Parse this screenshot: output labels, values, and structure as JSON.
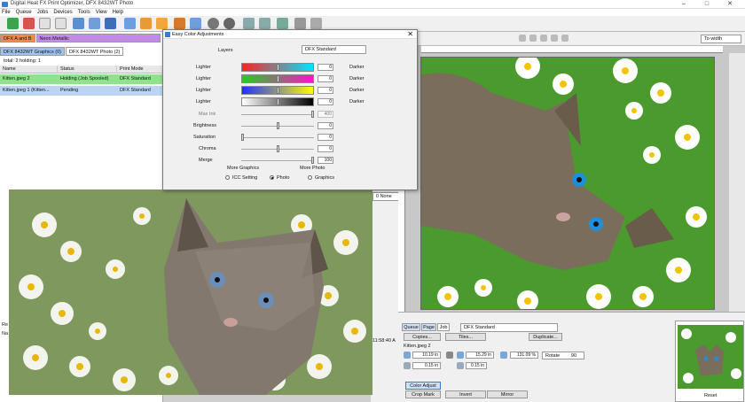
{
  "window": {
    "title": "Digital Heat FX Print Optimizer, DFX 8432WT Photo"
  },
  "menu": [
    "File",
    "Queue",
    "Jobs",
    "Devices",
    "Tools",
    "View",
    "Help"
  ],
  "left_panel": {
    "printer_tabs": [
      "DFX A and B",
      "Neon Metallic"
    ],
    "queue_tabs": [
      "DFX 8432WT Graphics (0)",
      "DFX 8432WT Photo (2)"
    ],
    "summary": "total: 2  holding: 1",
    "columns": [
      "Name",
      "Status",
      "Print Mode"
    ],
    "rows": [
      {
        "name": "Kitten.jpeg 2",
        "status": "Holding (Job Spooled)",
        "mode": "DFX Standard"
      },
      {
        "name": "Kitten.jpeg 1 (Kitten...",
        "status": "Pending",
        "mode": "DFX Standard"
      }
    ],
    "lower_items": [
      "Re",
      "Na"
    ]
  },
  "dialog": {
    "title": "Easy Color Adjustments",
    "layers_label": "Layers",
    "layers_value": "DFX Standard",
    "channels": [
      {
        "left": "Lighter",
        "right": "Darker",
        "value": "0",
        "pos": 0.5,
        "from": "#ff2020",
        "to": "#00e5ff"
      },
      {
        "left": "Lighter",
        "right": "Darker",
        "value": "0",
        "pos": 0.5,
        "from": "#20d020",
        "to": "#ff10c8"
      },
      {
        "left": "Lighter",
        "right": "Darker",
        "value": "0",
        "pos": 0.5,
        "from": "#2030ff",
        "to": "#ffff00"
      },
      {
        "left": "Lighter",
        "right": "Darker",
        "value": "0",
        "pos": 0.5,
        "from": "#ffffff",
        "to": "#000000"
      }
    ],
    "sliders": [
      {
        "label": "Max Ink",
        "value": "400",
        "pos": 1.0,
        "disabled": true
      },
      {
        "label": "Brightness",
        "value": "0",
        "pos": 0.5
      },
      {
        "label": "Saturation",
        "value": "0",
        "pos": 0.0
      },
      {
        "label": "Chroma",
        "value": "0",
        "pos": 0.5
      },
      {
        "label": "Merge",
        "value": "100",
        "pos": 1.0
      }
    ],
    "more_graphics": "More Graphics",
    "more_photo": "More Photo",
    "radios": [
      {
        "label": "ICC Setting",
        "checked": false
      },
      {
        "label": "Photo",
        "checked": true
      },
      {
        "label": "Graphics",
        "checked": false
      }
    ]
  },
  "behind_dialog": {
    "select_value": "0 None",
    "time": "11:58:40 A"
  },
  "right_toolbar": {
    "zoom": "To width"
  },
  "bottom": {
    "tabs": [
      "Queue",
      "Page",
      "Job"
    ],
    "print_mode": "DFX Standard",
    "buttons": {
      "copies": "Copies...",
      "tiles": "Tiles...",
      "duplicate": "Duplicate..."
    },
    "filename": "Kitten.jpeg 2",
    "width": "10.19 in",
    "height": "15.29 in",
    "scale": "131.09 %",
    "rotate_label": "Rotate",
    "rotate_value": "90",
    "offset_x": "0.15 in",
    "offset_y": "0.15 in",
    "color_adjust": "Color Adjust",
    "crop_mark": "Crop Mark",
    "invert": "Invert",
    "mirror": "Mirror",
    "reset": "Reset"
  },
  "colors": {
    "accent_green": "#8fe38a",
    "accent_blue": "#b9d4f5",
    "tab_orange": "#f08a4a",
    "tab_purple": "#c48ae8"
  }
}
